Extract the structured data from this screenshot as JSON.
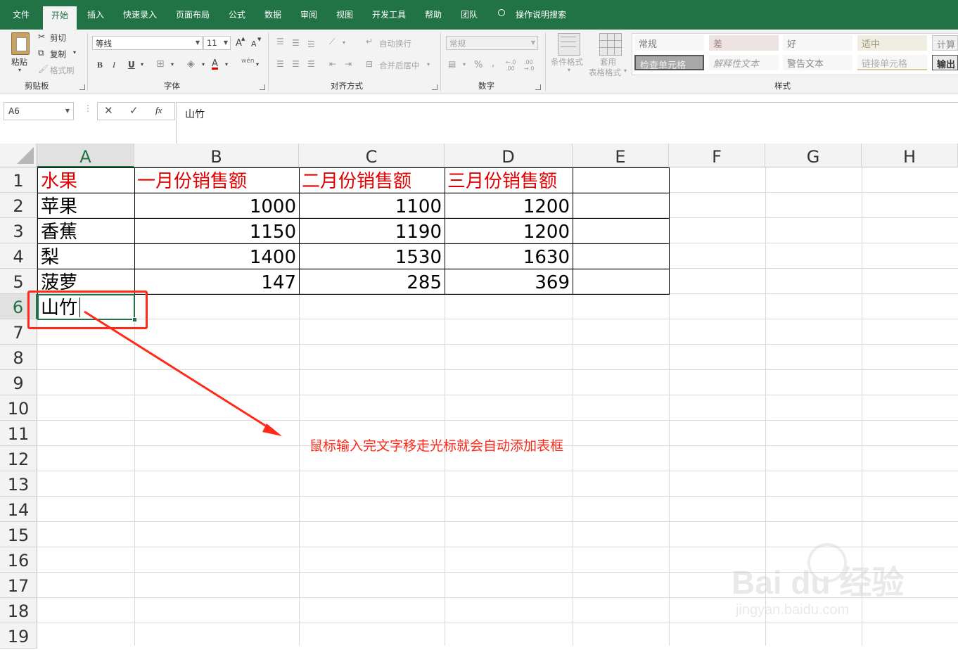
{
  "ribbon_tabs": [
    "文件",
    "开始",
    "插入",
    "快速录入",
    "页面布局",
    "公式",
    "数据",
    "审阅",
    "视图",
    "开发工具",
    "帮助",
    "团队"
  ],
  "tell_me": "操作说明搜索",
  "clipboard": {
    "paste": "粘贴",
    "cut": "剪切",
    "copy": "复制",
    "format_painter": "格式刷",
    "group": "剪贴板"
  },
  "font": {
    "name": "等线",
    "size": "11",
    "bold": "B",
    "italic": "I",
    "underline": "U",
    "grow": "A",
    "shrink": "A",
    "phonetic": "wén",
    "group": "字体",
    "font_color": "#e00000"
  },
  "alignment": {
    "wrap": "自动换行",
    "merge": "合并后居中",
    "group": "对齐方式"
  },
  "number": {
    "format": "常规",
    "percent": "%",
    "comma": ",",
    "inc": "←.0 .00",
    "dec": ".00 →.0",
    "group": "数字"
  },
  "styles": {
    "conditional": "条件格式",
    "table_line1": "套用",
    "table_line2": "表格格式",
    "group": "样式",
    "cells": [
      "常规",
      "差",
      "好",
      "适中",
      "计算",
      "检查单元格",
      "解释性文本",
      "警告文本",
      "链接单元格",
      "输出"
    ]
  },
  "formula_bar": {
    "name_box": "A6",
    "fx": "fx",
    "content": "山竹"
  },
  "columns": [
    "A",
    "B",
    "C",
    "D",
    "E",
    "F",
    "G",
    "H"
  ],
  "rows": [
    "1",
    "2",
    "3",
    "4",
    "5",
    "6",
    "7",
    "8",
    "9",
    "10",
    "11",
    "12",
    "13",
    "14",
    "15",
    "16",
    "17",
    "18",
    "19"
  ],
  "table": {
    "headers": [
      "水果",
      "一月份销售额",
      "二月份销售额",
      "三月份销售额"
    ],
    "rows": [
      [
        "苹果",
        "1000",
        "1100",
        "1200"
      ],
      [
        "香蕉",
        "1150",
        "1190",
        "1200"
      ],
      [
        "梨",
        "1400",
        "1530",
        "1630"
      ],
      [
        "菠萝",
        "147",
        "285",
        "369"
      ]
    ],
    "editing_cell": "山竹"
  },
  "annotation": {
    "text": "鼠标输入完文字移走光标就会自动添加表框",
    "color": "#ff2a1a"
  },
  "watermark": {
    "logo": "Bai du 经验",
    "url": "jingyan.baidu.com"
  },
  "colors": {
    "excel_green": "#217346",
    "header_red": "#e00000"
  }
}
